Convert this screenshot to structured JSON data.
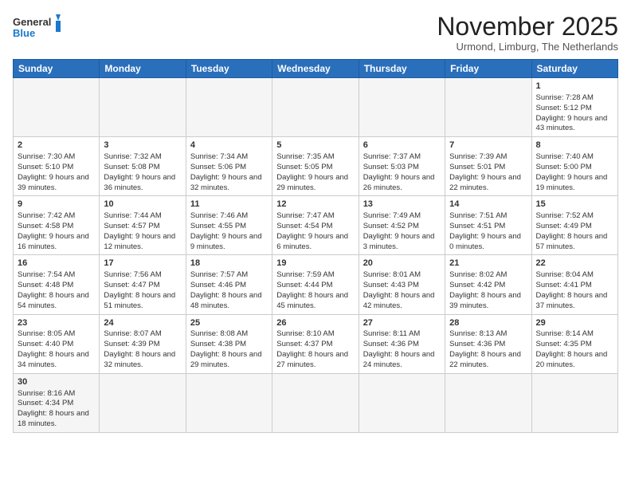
{
  "logo": {
    "text_general": "General",
    "text_blue": "Blue"
  },
  "header": {
    "month_title": "November 2025",
    "subtitle": "Urmond, Limburg, The Netherlands"
  },
  "weekdays": [
    "Sunday",
    "Monday",
    "Tuesday",
    "Wednesday",
    "Thursday",
    "Friday",
    "Saturday"
  ],
  "days": [
    {
      "num": "",
      "empty": true
    },
    {
      "num": "",
      "empty": true
    },
    {
      "num": "",
      "empty": true
    },
    {
      "num": "",
      "empty": true
    },
    {
      "num": "",
      "empty": true
    },
    {
      "num": "",
      "empty": true
    },
    {
      "num": "1",
      "sunrise": "7:28 AM",
      "sunset": "5:12 PM",
      "daylight": "9 hours and 43 minutes."
    },
    {
      "num": "2",
      "sunrise": "7:30 AM",
      "sunset": "5:10 PM",
      "daylight": "9 hours and 39 minutes."
    },
    {
      "num": "3",
      "sunrise": "7:32 AM",
      "sunset": "5:08 PM",
      "daylight": "9 hours and 36 minutes."
    },
    {
      "num": "4",
      "sunrise": "7:34 AM",
      "sunset": "5:06 PM",
      "daylight": "9 hours and 32 minutes."
    },
    {
      "num": "5",
      "sunrise": "7:35 AM",
      "sunset": "5:05 PM",
      "daylight": "9 hours and 29 minutes."
    },
    {
      "num": "6",
      "sunrise": "7:37 AM",
      "sunset": "5:03 PM",
      "daylight": "9 hours and 26 minutes."
    },
    {
      "num": "7",
      "sunrise": "7:39 AM",
      "sunset": "5:01 PM",
      "daylight": "9 hours and 22 minutes."
    },
    {
      "num": "8",
      "sunrise": "7:40 AM",
      "sunset": "5:00 PM",
      "daylight": "9 hours and 19 minutes."
    },
    {
      "num": "9",
      "sunrise": "7:42 AM",
      "sunset": "4:58 PM",
      "daylight": "9 hours and 16 minutes."
    },
    {
      "num": "10",
      "sunrise": "7:44 AM",
      "sunset": "4:57 PM",
      "daylight": "9 hours and 12 minutes."
    },
    {
      "num": "11",
      "sunrise": "7:46 AM",
      "sunset": "4:55 PM",
      "daylight": "9 hours and 9 minutes."
    },
    {
      "num": "12",
      "sunrise": "7:47 AM",
      "sunset": "4:54 PM",
      "daylight": "9 hours and 6 minutes."
    },
    {
      "num": "13",
      "sunrise": "7:49 AM",
      "sunset": "4:52 PM",
      "daylight": "9 hours and 3 minutes."
    },
    {
      "num": "14",
      "sunrise": "7:51 AM",
      "sunset": "4:51 PM",
      "daylight": "9 hours and 0 minutes."
    },
    {
      "num": "15",
      "sunrise": "7:52 AM",
      "sunset": "4:49 PM",
      "daylight": "8 hours and 57 minutes."
    },
    {
      "num": "16",
      "sunrise": "7:54 AM",
      "sunset": "4:48 PM",
      "daylight": "8 hours and 54 minutes."
    },
    {
      "num": "17",
      "sunrise": "7:56 AM",
      "sunset": "4:47 PM",
      "daylight": "8 hours and 51 minutes."
    },
    {
      "num": "18",
      "sunrise": "7:57 AM",
      "sunset": "4:46 PM",
      "daylight": "8 hours and 48 minutes."
    },
    {
      "num": "19",
      "sunrise": "7:59 AM",
      "sunset": "4:44 PM",
      "daylight": "8 hours and 45 minutes."
    },
    {
      "num": "20",
      "sunrise": "8:01 AM",
      "sunset": "4:43 PM",
      "daylight": "8 hours and 42 minutes."
    },
    {
      "num": "21",
      "sunrise": "8:02 AM",
      "sunset": "4:42 PM",
      "daylight": "8 hours and 39 minutes."
    },
    {
      "num": "22",
      "sunrise": "8:04 AM",
      "sunset": "4:41 PM",
      "daylight": "8 hours and 37 minutes."
    },
    {
      "num": "23",
      "sunrise": "8:05 AM",
      "sunset": "4:40 PM",
      "daylight": "8 hours and 34 minutes."
    },
    {
      "num": "24",
      "sunrise": "8:07 AM",
      "sunset": "4:39 PM",
      "daylight": "8 hours and 32 minutes."
    },
    {
      "num": "25",
      "sunrise": "8:08 AM",
      "sunset": "4:38 PM",
      "daylight": "8 hours and 29 minutes."
    },
    {
      "num": "26",
      "sunrise": "8:10 AM",
      "sunset": "4:37 PM",
      "daylight": "8 hours and 27 minutes."
    },
    {
      "num": "27",
      "sunrise": "8:11 AM",
      "sunset": "4:36 PM",
      "daylight": "8 hours and 24 minutes."
    },
    {
      "num": "28",
      "sunrise": "8:13 AM",
      "sunset": "4:36 PM",
      "daylight": "8 hours and 22 minutes."
    },
    {
      "num": "29",
      "sunrise": "8:14 AM",
      "sunset": "4:35 PM",
      "daylight": "8 hours and 20 minutes."
    },
    {
      "num": "30",
      "sunrise": "8:16 AM",
      "sunset": "4:34 PM",
      "daylight": "8 hours and 18 minutes."
    },
    {
      "num": "",
      "empty": true
    },
    {
      "num": "",
      "empty": true
    },
    {
      "num": "",
      "empty": true
    },
    {
      "num": "",
      "empty": true
    },
    {
      "num": "",
      "empty": true
    },
    {
      "num": "",
      "empty": true
    }
  ]
}
